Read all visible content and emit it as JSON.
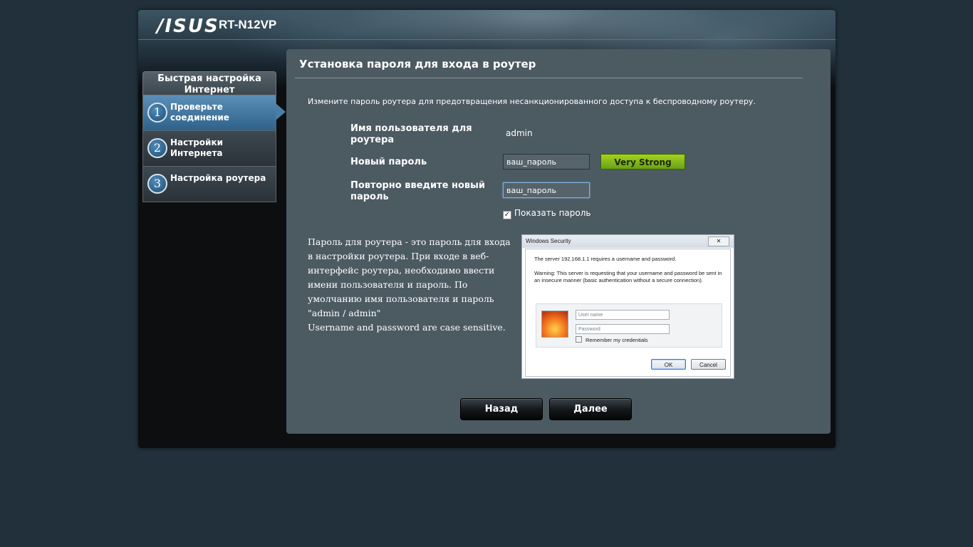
{
  "header": {
    "brand": "/ISUS",
    "model": "RT-N12VP"
  },
  "sidebar": {
    "title": "Быстрая настройка Интернет",
    "items": [
      {
        "num": "1",
        "label": "Проверьте соединение",
        "active": true
      },
      {
        "num": "2",
        "label": "Настройки Интернета",
        "active": false
      },
      {
        "num": "3",
        "label": "Настройка роутера",
        "active": false
      }
    ]
  },
  "main": {
    "title": "Установка пароля для входа в роутер",
    "description": "Измените пароль роутера для предотвращения несанкционированного доступа к беспроводному роутеру.",
    "username_label": "Имя пользователя для роутера",
    "username_value": "admin",
    "new_password_label": "Новый пароль",
    "new_password_value": "ваш_пароль",
    "strength": "Very Strong",
    "confirm_password_label": "Повторно введите новый пароль",
    "confirm_password_value": "ваш_пароль",
    "show_password_label": "Показать пароль",
    "show_password_checked": true,
    "info_text": "Пароль для роутера - это пароль для входа в настройки роутера. При входе в веб-интерфейс роутера, необходимо ввести имени пользователя и пароль. По умолчанию имя пользователя и пароль \"admin / admin\"",
    "info_note": "Username and password are case sensitive."
  },
  "windows_security": {
    "title": "Windows Security",
    "message": "The server 192.168.1.1  requires a username and password.",
    "warning": "Warning: This server is requesting that your username and password be sent in an insecure manner (basic authentication without a secure connection).",
    "username_placeholder": "User name",
    "password_placeholder": "Password",
    "remember": "Remember my credentials",
    "ok": "OK",
    "cancel": "Cancel"
  },
  "buttons": {
    "back": "Назад",
    "next": "Далее"
  },
  "colors": {
    "strength_bar": "#8cc11c",
    "active_step": "#3f74a0",
    "panel": "#4c5a62"
  }
}
